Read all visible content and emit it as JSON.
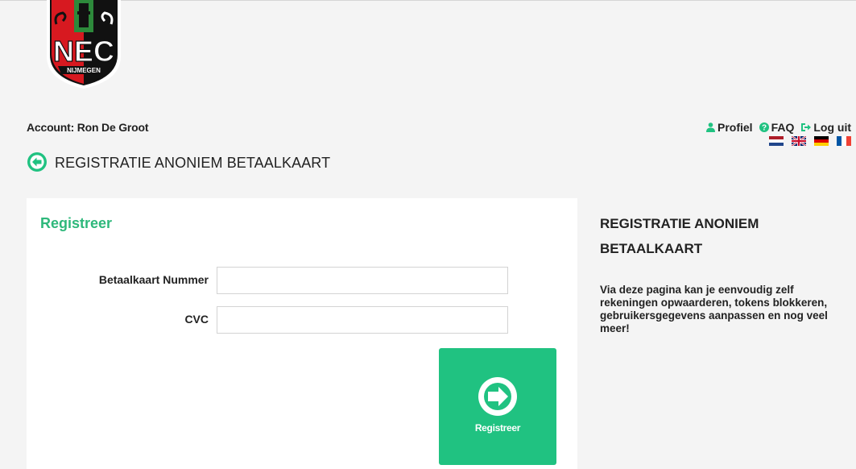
{
  "logo": {
    "text": "NEC",
    "subtext": "NIJMEGEN",
    "colors": {
      "red": "#d71920",
      "green": "#2d8a3b",
      "black": "#111111"
    }
  },
  "account": {
    "label": "Account: Ron De Groot"
  },
  "nav": {
    "profile_label": "Profiel",
    "faq_label": "FAQ",
    "logout_label": "Log uit"
  },
  "languages": [
    "nl",
    "en",
    "de",
    "fr"
  ],
  "page": {
    "title": "REGISTRATIE ANONIEM BETAALKAART"
  },
  "form": {
    "title": "Registreer",
    "card_number": {
      "label": "Betaalkaart Nummer",
      "value": ""
    },
    "cvc": {
      "label": "CVC",
      "value": ""
    },
    "submit_label": "Registreer"
  },
  "sidebar": {
    "title": "REGISTRATIE ANONIEM BETAALKAART",
    "text": "Via deze pagina kan je eenvoudig zelf rekeningen opwaarderen, tokens blokkeren, gebruikersgegevens aanpassen en nog veel meer!"
  },
  "colors": {
    "accent": "#2eb87b",
    "button": "#20c281",
    "background": "#f4f4f4"
  }
}
